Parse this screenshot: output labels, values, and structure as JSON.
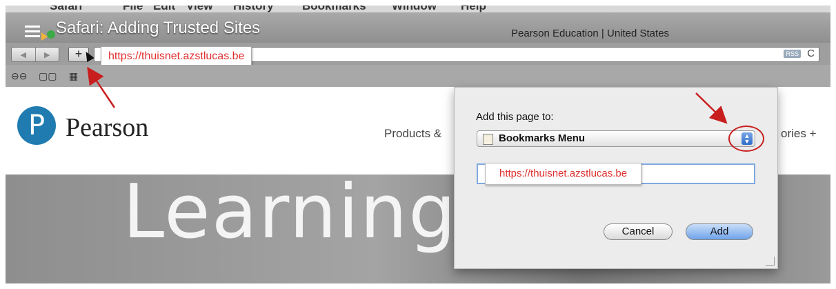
{
  "menubar": {
    "app": "Safari",
    "items": [
      "File",
      "Edit",
      "View",
      "History",
      "Bookmarks",
      "Window",
      "Help"
    ]
  },
  "video": {
    "title": "Safari: Adding Trusted Sites"
  },
  "window": {
    "title": "Pearson Education | United States"
  },
  "toolbar": {
    "back": "◀",
    "forward": "▶",
    "add_bookmark": "+",
    "rss": "RSS",
    "reload": "C"
  },
  "url_callout": "https://thuisnet.azstlucas.be",
  "bookmarks_bar": {
    "reader": "⊖⊖",
    "book": "▢▢",
    "grid": "▦"
  },
  "site": {
    "logo_letter": "P",
    "logo_text": "Pearson",
    "nav_left": "Products &",
    "nav_right": "ories +",
    "hero": "Learning"
  },
  "dialog": {
    "label": "Add this page to:",
    "location": "Bookmarks Menu",
    "name_value": "https://thuisnet.azstlucas.be",
    "cancel": "Cancel",
    "add": "Add"
  },
  "colors": {
    "annotation": "#c81e1e",
    "callout_text": "#e03030",
    "pearson_blue": "#1f7bb0"
  }
}
